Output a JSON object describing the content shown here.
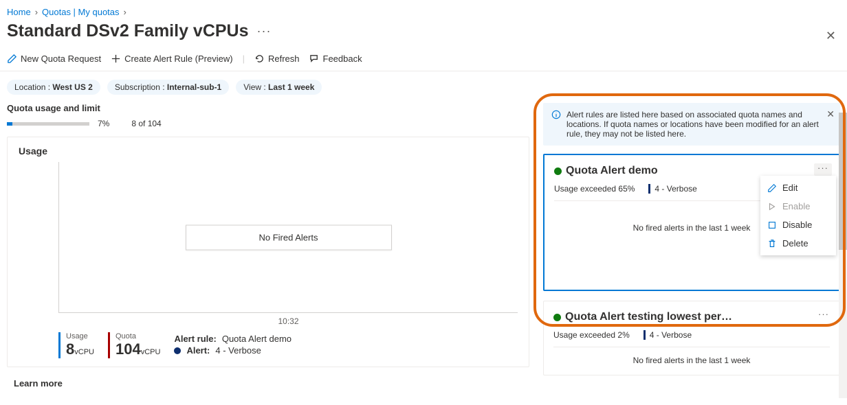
{
  "breadcrumb": [
    {
      "label": "Home"
    },
    {
      "label": "Quotas | My quotas"
    }
  ],
  "page_title": "Standard DSv2 Family vCPUs",
  "toolbar": {
    "new_request": "New Quota Request",
    "create_rule": "Create Alert Rule (Preview)",
    "refresh": "Refresh",
    "feedback": "Feedback"
  },
  "filters": {
    "location_label": "Location : ",
    "location_value": "West US 2",
    "subscription_label": "Subscription : ",
    "subscription_value": "Internal-sub-1",
    "view_label": "View : ",
    "view_value": "Last 1 week"
  },
  "quota_usage": {
    "heading": "Quota usage and limit",
    "percent": "7%",
    "fraction": "8 of 104"
  },
  "chart": {
    "title": "Usage",
    "no_alerts": "No Fired Alerts",
    "x_tick": "10:32",
    "usage_label": "Usage",
    "usage_value": "8",
    "usage_unit": "vCPU",
    "quota_label": "Quota",
    "quota_value": "104",
    "quota_unit": "vCPU",
    "alert_rule_label": "Alert rule:",
    "alert_rule_value": "Quota Alert demo",
    "alert_label": "Alert:",
    "alert_value": "4 - Verbose"
  },
  "learn_more": "Learn more",
  "info_banner": "Alert rules are listed here based on associated quota names and locations. If quota names or locations have been modified for an alert rule, they may not be listed here.",
  "alert_cards": {
    "demo": {
      "name": "Quota Alert demo",
      "usage": "Usage exceeded 65%",
      "severity": "4 - Verbose",
      "no_fired": "No fired alerts in the last 1 week"
    },
    "testing": {
      "name": "Quota Alert testing lowest per…",
      "usage": "Usage exceeded 2%",
      "severity": "4 - Verbose",
      "no_fired": "No fired alerts in the last 1 week"
    }
  },
  "context_menu": {
    "edit": "Edit",
    "enable": "Enable",
    "disable": "Disable",
    "delete": "Delete"
  },
  "chart_data": {
    "type": "line",
    "title": "Usage",
    "series": [
      {
        "name": "Usage (vCPU)",
        "values": [
          8
        ]
      },
      {
        "name": "Quota (vCPU)",
        "values": [
          104
        ]
      }
    ],
    "x": [
      "10:32"
    ],
    "fired_alerts": []
  }
}
